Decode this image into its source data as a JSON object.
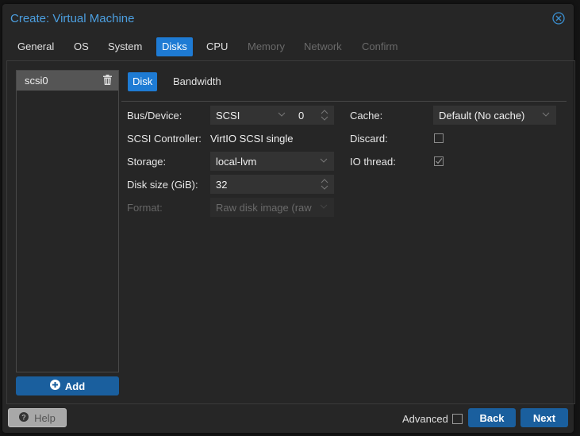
{
  "window": {
    "title": "Create: Virtual Machine",
    "close_icon": "circle-x-icon",
    "accent_color": "#1e7bd4"
  },
  "tabs": [
    {
      "label": "General",
      "state": "normal"
    },
    {
      "label": "OS",
      "state": "normal"
    },
    {
      "label": "System",
      "state": "normal"
    },
    {
      "label": "Disks",
      "state": "active"
    },
    {
      "label": "CPU",
      "state": "normal"
    },
    {
      "label": "Memory",
      "state": "disabled"
    },
    {
      "label": "Network",
      "state": "disabled"
    },
    {
      "label": "Confirm",
      "state": "disabled"
    }
  ],
  "disk_list": {
    "items": [
      {
        "label": "scsi0",
        "icon": "trash-icon"
      }
    ],
    "add_label": "Add",
    "add_icon": "plus-circle-icon"
  },
  "subtabs": [
    {
      "label": "Disk",
      "state": "active"
    },
    {
      "label": "Bandwidth",
      "state": "normal"
    }
  ],
  "form": {
    "bus_device": {
      "label": "Bus/Device:",
      "bus": "SCSI",
      "device": "0"
    },
    "scsi_controller": {
      "label": "SCSI Controller:",
      "value": "VirtIO SCSI single"
    },
    "storage": {
      "label": "Storage:",
      "value": "local-lvm"
    },
    "disk_size": {
      "label": "Disk size (GiB):",
      "value": "32"
    },
    "format": {
      "label": "Format:",
      "value": "Raw disk image (raw"
    },
    "cache": {
      "label": "Cache:",
      "value": "Default (No cache)"
    },
    "discard": {
      "label": "Discard:",
      "checked": false
    },
    "io_thread": {
      "label": "IO thread:",
      "checked": true
    }
  },
  "footer": {
    "help_label": "Help",
    "help_icon": "question-circle-icon",
    "advanced_label": "Advanced",
    "advanced_checked": false,
    "back_label": "Back",
    "next_label": "Next"
  }
}
